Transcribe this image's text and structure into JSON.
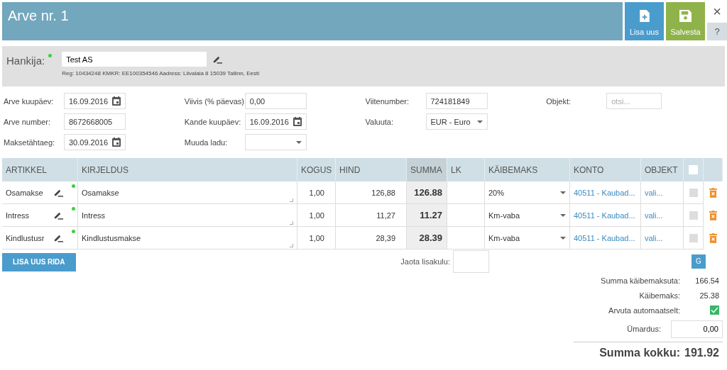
{
  "title": "Arve nr. 1",
  "actions": [
    {
      "kind": "new",
      "label": "Lisa uus"
    },
    {
      "kind": "save",
      "label": "Salvesta"
    }
  ],
  "window_controls": [
    {
      "kind": "close",
      "label": "×"
    },
    {
      "kind": "help",
      "label": "?"
    }
  ],
  "supplier": {
    "label": "Hankija:",
    "required": true,
    "value": "Test AS",
    "details": "Reg: 10434248 KMKR: EE100354546 Aadress: Liivalaia 8 15039 Tallinn, Eesti"
  },
  "form_columns": [
    [
      {
        "label": "Arve kuupäev:",
        "kind": "date",
        "value": "16.09.2016"
      },
      {
        "label": "Arve number:",
        "kind": "text",
        "value": "8672668005"
      },
      {
        "label": "Maksetähtaeg:",
        "kind": "date",
        "value": "30.09.2016"
      }
    ],
    [
      {
        "label": "Viivis (% päevas):",
        "kind": "text",
        "value": "0,00"
      },
      {
        "label": "Kande kuupäev:",
        "kind": "date",
        "value": "16.09.2016"
      },
      {
        "label": "Muuda ladu:",
        "kind": "select"
      }
    ],
    [
      {
        "label": "Viitenumber:",
        "kind": "text",
        "value": "724181849"
      },
      {
        "label": "Valuuta:",
        "kind": "select",
        "value": "EUR - Euro"
      }
    ],
    [
      {
        "label": "Objekt:",
        "kind": "search",
        "placeholder": "otsi..."
      }
    ]
  ],
  "table": {
    "columns": [
      "ARTIKKEL",
      "KIRJELDUS",
      "KOGUS",
      "HIND",
      "SUMMA",
      "LK",
      "KÄIBEMAKS",
      "KONTO",
      "OBJEKT"
    ],
    "all_checked": false,
    "rows": [
      {
        "article": "Osamakse",
        "marked": true,
        "description": "Osamakse",
        "quantity": "1,00",
        "price": "126,88",
        "sum": "126.88",
        "vat": "20%",
        "account": "40511 - Kaubad...",
        "object": "vali...",
        "checked": false
      },
      {
        "article": "Intress",
        "marked": true,
        "description": "Intress",
        "quantity": "1,00",
        "price": "11,27",
        "sum": "11.27",
        "vat": "Km-vaba",
        "account": "40511 - Kaubad...",
        "object": "vali...",
        "checked": false
      },
      {
        "article": "Kindlustusr",
        "marked": true,
        "description": "Kindlustusmakse",
        "quantity": "1,00",
        "price": "28,39",
        "sum": "28.39",
        "vat": "Km-vaba",
        "account": "40511 - Kaubad...",
        "object": "vali...",
        "checked": false
      }
    ]
  },
  "add_row_button": "LISA UUS RIDA",
  "extra_cost": {
    "label": "Jaota lisakulu:"
  },
  "g_button": "G",
  "totals": {
    "net_label": "Summa käibemaksuta:",
    "net": "166.54",
    "vat_label": "Käibemaks:",
    "vat": "25.38",
    "auto_label": "Arvuta automaatselt:",
    "auto": true,
    "rounding_label": "Ümardus:",
    "rounding": "0,00",
    "total_label": "Summa kokku:",
    "total": "191.92"
  }
}
